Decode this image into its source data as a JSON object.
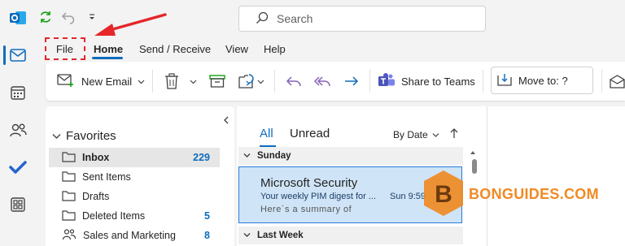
{
  "search": {
    "placeholder": "Search"
  },
  "menu_tabs": [
    "File",
    "Home",
    "Send / Receive",
    "View",
    "Help"
  ],
  "ribbon": {
    "new_email": "New Email",
    "share_to_teams": "Share to Teams",
    "move_to": "Move to: ?"
  },
  "folders": {
    "favorites_label": "Favorites",
    "items": [
      {
        "name": "Inbox",
        "count": "229",
        "icon": "folder-icon"
      },
      {
        "name": "Sent Items",
        "count": "",
        "icon": "folder-icon"
      },
      {
        "name": "Drafts",
        "count": "",
        "icon": "folder-icon"
      },
      {
        "name": "Deleted Items",
        "count": "5",
        "icon": "folder-icon"
      },
      {
        "name": "Sales and Marketing",
        "count": "8",
        "icon": "group-icon"
      }
    ]
  },
  "message_list": {
    "tabs": [
      "All",
      "Unread"
    ],
    "sort_label": "By Date",
    "groups": [
      "Sunday",
      "Last Week"
    ],
    "selected_message": {
      "sender": "Microsoft Security",
      "subject": "Your weekly PIM digest for ...",
      "time": "Sun 9:59",
      "preview": "Here´s a summary of"
    }
  },
  "watermark": {
    "text": "BONGUIDES.COM",
    "letter": "B"
  },
  "colors": {
    "accent": "#0f6cbd",
    "highlight_box": "#e5262a",
    "arrow": "#e5262a",
    "watermark": "#f08a24"
  }
}
